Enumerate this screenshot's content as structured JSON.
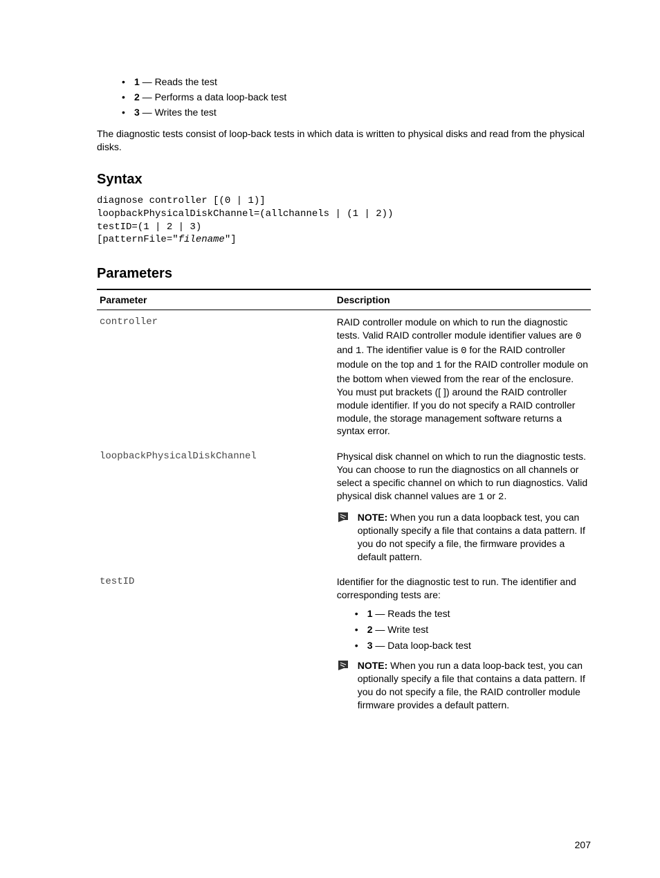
{
  "top_list": [
    {
      "num": "1",
      "text": " — Reads the test"
    },
    {
      "num": "2",
      "text": " — Performs a data loop-back test"
    },
    {
      "num": "3",
      "text": " — Writes the test"
    }
  ],
  "intro_text": "The diagnostic tests consist of loop-back tests in which data is written to physical disks and read from the physical disks.",
  "syntax_heading": "Syntax",
  "syntax_lines": {
    "l1": "diagnose controller [(0 | 1)]",
    "l2": "loopbackPhysicalDiskChannel=(allchannels | (1 | 2))",
    "l3": "testID=(1 | 2 | 3)",
    "l4a": "[patternFile=\"",
    "l4b": "filename",
    "l4c": "\"]"
  },
  "parameters_heading": "Parameters",
  "table": {
    "header_param": "Parameter",
    "header_desc": "Description",
    "rows": {
      "controller": {
        "name": "controller",
        "desc_pre": "RAID controller module on which to run the diagnostic tests. Valid RAID controller module identifier values are ",
        "zero": "0",
        "desc_mid1": " and ",
        "one": "1",
        "desc_mid2": ". The identifier value is ",
        "zero2": "0",
        "desc_mid3": " for the RAID controller module on the top and ",
        "one2": "1",
        "desc_mid4": " for the RAID controller module on the bottom when viewed from the rear of the enclosure. You must put brackets ([ ]) around the RAID controller module identifier. If you do not specify a RAID controller module, the storage management software returns a syntax error."
      },
      "loopback": {
        "name": "loopbackPhysicalDiskChannel",
        "desc_pre": "Physical disk channel on which to run the diagnostic tests. You can choose to run the diagnostics on all channels or select a specific channel on which to run diagnostics. Valid physical disk channel values are ",
        "one": "1",
        "desc_mid": " or ",
        "two": "2",
        "desc_post": ".",
        "note_label": "NOTE:",
        "note_text": " When you run a data loopback test, you can optionally specify a file that contains a data pattern. If you do not specify a file, the firmware provides a default pattern."
      },
      "testid": {
        "name": "testID",
        "desc": "Identifier for the diagnostic test to run. The identifier and corresponding tests are:",
        "items": [
          {
            "num": "1",
            "text": " — Reads the test"
          },
          {
            "num": "2",
            "text": " — Write test"
          },
          {
            "num": "3",
            "text": " — Data loop-back test"
          }
        ],
        "note_label": "NOTE:",
        "note_text": " When you run a data loop-back test, you can optionally specify a file that contains a data pattern. If you do not specify a file, the RAID controller module firmware provides a default pattern."
      }
    }
  },
  "page_number": "207"
}
